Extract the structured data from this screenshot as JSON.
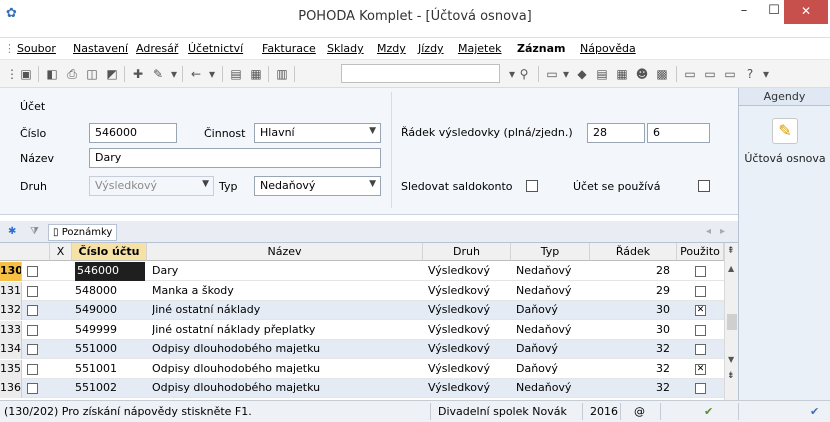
{
  "window": {
    "title": "POHODA Komplet - [Účtová osnova]"
  },
  "menu": [
    "Soubor",
    "Nastavení",
    "Adresář",
    "Účetnictví",
    "Fakturace",
    "Sklady",
    "Mzdy",
    "Jízdy",
    "Majetek",
    "Záznam",
    "Nápověda"
  ],
  "form": {
    "section_label": "Účet",
    "cislo_label": "Číslo",
    "cislo_value": "546000",
    "cinnost_label": "Činnost",
    "cinnost_value": "Hlavní",
    "nazev_label": "Název",
    "nazev_value": "Dary",
    "druh_label": "Druh",
    "druh_value": "Výsledkový",
    "typ_label": "Typ",
    "typ_value": "Nedaňový",
    "radek_label": "Řádek výsledovky (plná/zjedn.)",
    "radek_plna": "28",
    "radek_zjedn": "6",
    "saldokonto_label": "Sledovat saldokonto",
    "nepouziva_label": "Účet se používá"
  },
  "agendy": {
    "title": "Agendy",
    "item_label": "Účtová osnova"
  },
  "tabs": {
    "notes_label": "Poznámky"
  },
  "grid": {
    "headers": {
      "x": "X",
      "cislo": "Číslo účtu",
      "nazev": "Název",
      "druh": "Druh",
      "typ": "Typ",
      "radek": "Řádek",
      "pouzito": "Použito"
    },
    "rows": [
      {
        "num": "130",
        "cislo": "546000",
        "nazev": "Dary",
        "druh": "Výsledkový",
        "typ": "Nedaňový",
        "radek": "28",
        "pouzito": ""
      },
      {
        "num": "131",
        "cislo": "548000",
        "nazev": "Manka a škody",
        "druh": "Výsledkový",
        "typ": "Nedaňový",
        "radek": "29",
        "pouzito": ""
      },
      {
        "num": "132",
        "cislo": "549000",
        "nazev": "Jiné ostatní náklady",
        "druh": "Výsledkový",
        "typ": "Daňový",
        "radek": "30",
        "pouzito": "✕"
      },
      {
        "num": "133",
        "cislo": "549999",
        "nazev": "Jiné ostatní náklady   přeplatky",
        "druh": "Výsledkový",
        "typ": "Nedaňový",
        "radek": "30",
        "pouzito": ""
      },
      {
        "num": "134",
        "cislo": "551000",
        "nazev": "Odpisy dlouhodobého majetku",
        "druh": "Výsledkový",
        "typ": "Daňový",
        "radek": "32",
        "pouzito": ""
      },
      {
        "num": "135",
        "cislo": "551001",
        "nazev": "Odpisy dlouhodobého majetku",
        "druh": "Výsledkový",
        "typ": "Daňový",
        "radek": "32",
        "pouzito": "✕"
      },
      {
        "num": "136",
        "cislo": "551002",
        "nazev": "Odpisy dlouhodobého majetku",
        "druh": "Výsledkový",
        "typ": "Nedaňový",
        "radek": "32",
        "pouzito": ""
      }
    ]
  },
  "status": {
    "hint": "(130/202) Pro získání nápovědy stiskněte F1.",
    "company": "Divadelní spolek Novák",
    "year": "2016"
  }
}
